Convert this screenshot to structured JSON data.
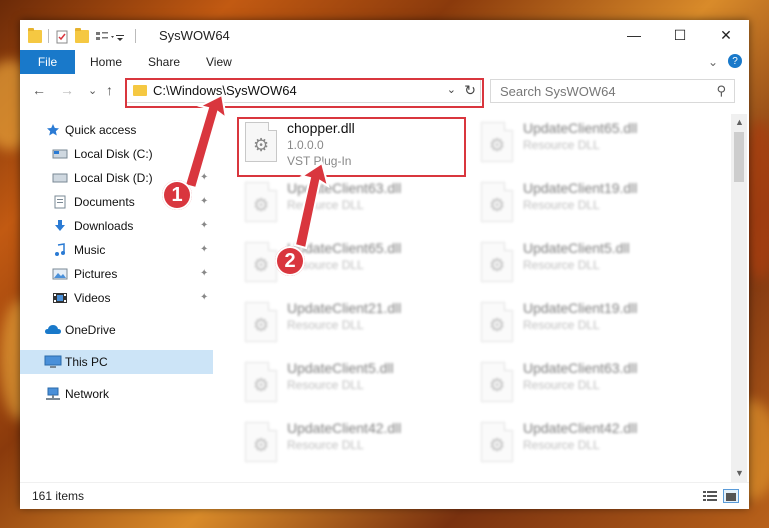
{
  "window": {
    "title": "SysWOW64",
    "minimize": "—",
    "maximize": "☐",
    "close": "✕"
  },
  "ribbon": {
    "file": "File",
    "tabs": [
      "Home",
      "Share",
      "View"
    ],
    "expand": "⌄",
    "help": "?"
  },
  "nav": {
    "back": "←",
    "forward": "→",
    "recent": "⌄",
    "up": "↑",
    "address": "C:\\Windows\\SysWOW64",
    "address_drop": "⌄",
    "refresh": "↻",
    "search_placeholder": "Search SysWOW64",
    "search_icon": "⚲"
  },
  "sidebar": {
    "items": [
      {
        "label": "Quick access",
        "icon": "star-icon"
      },
      {
        "label": "Local Disk (C:)",
        "icon": "drive-icon",
        "pinned": true
      },
      {
        "label": "Local Disk (D:)",
        "icon": "drive-icon",
        "pinned": true
      },
      {
        "label": "Documents",
        "icon": "documents-icon",
        "pinned": true
      },
      {
        "label": "Downloads",
        "icon": "download-icon",
        "pinned": true
      },
      {
        "label": "Music",
        "icon": "music-icon",
        "pinned": true
      },
      {
        "label": "Pictures",
        "icon": "pictures-icon",
        "pinned": true
      },
      {
        "label": "Videos",
        "icon": "video-icon",
        "pinned": true
      },
      {
        "label": "OneDrive",
        "icon": "cloud-icon"
      },
      {
        "label": "This PC",
        "icon": "computer-icon",
        "selected": true
      },
      {
        "label": "Network",
        "icon": "network-icon"
      }
    ],
    "pin_glyph": "📌"
  },
  "files": {
    "left": [
      {
        "name": "chopper.dll",
        "line2": "1.0.0.0",
        "line3": "VST Plug-In"
      },
      {
        "name": "UpdateClient63.dll",
        "line2": "Resource DLL",
        "line3": ""
      },
      {
        "name": "UpdateClient65.dll",
        "line2": "Resource DLL",
        "line3": ""
      },
      {
        "name": "UpdateClient21.dll",
        "line2": "Resource DLL",
        "line3": ""
      },
      {
        "name": "UpdateClient5.dll",
        "line2": "Resource DLL",
        "line3": ""
      },
      {
        "name": "UpdateClient42.dll",
        "line2": "Resource DLL",
        "line3": ""
      }
    ],
    "right": [
      {
        "name": "UpdateClient65.dll",
        "line2": "Resource DLL"
      },
      {
        "name": "UpdateClient19.dll",
        "line2": "Resource DLL"
      },
      {
        "name": "UpdateClient5.dll",
        "line2": "Resource DLL"
      },
      {
        "name": "UpdateClient19.dll",
        "line2": "Resource DLL"
      },
      {
        "name": "UpdateClient63.dll",
        "line2": "Resource DLL"
      },
      {
        "name": "UpdateClient42.dll",
        "line2": "Resource DLL"
      }
    ]
  },
  "status": {
    "count": "161 items"
  },
  "callouts": {
    "one": "1",
    "two": "2"
  },
  "colors": {
    "accent": "#1979ca",
    "highlight": "#d9363e",
    "selected": "#cce4f7"
  }
}
